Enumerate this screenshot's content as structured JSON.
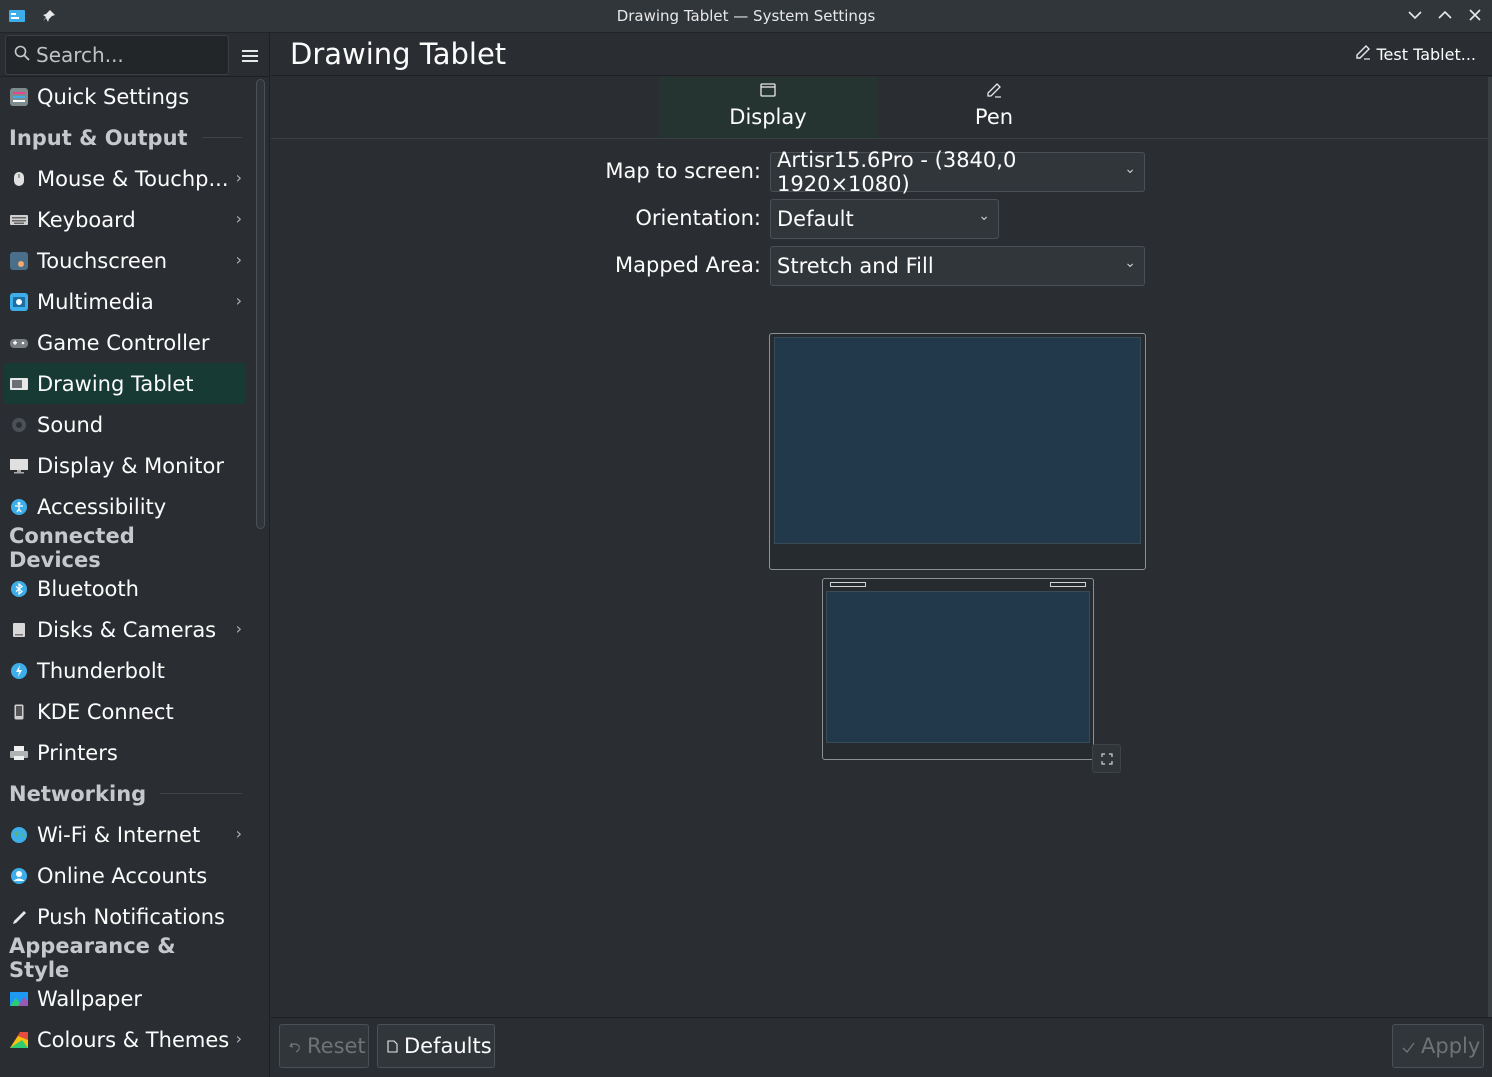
{
  "window": {
    "title": "Drawing Tablet — System Settings"
  },
  "search": {
    "placeholder": "Search..."
  },
  "sidebar": {
    "top_item": {
      "label": "Quick Settings",
      "icon": "quick-settings-icon"
    },
    "sections": [
      {
        "heading": "Input & Output",
        "items": [
          {
            "label": "Mouse & Touchp...",
            "icon": "mouse-icon",
            "chevron": true
          },
          {
            "label": "Keyboard",
            "icon": "keyboard-icon",
            "chevron": true
          },
          {
            "label": "Touchscreen",
            "icon": "touchscreen-icon",
            "chevron": true
          },
          {
            "label": "Multimedia",
            "icon": "multimedia-icon",
            "chevron": true
          },
          {
            "label": "Game Controller",
            "icon": "gamepad-icon",
            "chevron": false
          },
          {
            "label": "Drawing Tablet",
            "icon": "tablet-icon",
            "chevron": false,
            "active": true
          },
          {
            "label": "Sound",
            "icon": "speaker-icon",
            "chevron": false
          },
          {
            "label": "Display & Monitor",
            "icon": "monitor-icon",
            "chevron": false
          },
          {
            "label": "Accessibility",
            "icon": "accessibility-icon",
            "chevron": false
          }
        ]
      },
      {
        "heading": "Connected Devices",
        "items": [
          {
            "label": "Bluetooth",
            "icon": "bluetooth-icon",
            "chevron": false
          },
          {
            "label": "Disks & Cameras",
            "icon": "disk-icon",
            "chevron": true
          },
          {
            "label": "Thunderbolt",
            "icon": "thunderbolt-icon",
            "chevron": false
          },
          {
            "label": "KDE Connect",
            "icon": "phone-icon",
            "chevron": false
          },
          {
            "label": "Printers",
            "icon": "printer-icon",
            "chevron": false
          }
        ]
      },
      {
        "heading": "Networking",
        "items": [
          {
            "label": "Wi-Fi & Internet",
            "icon": "globe-icon",
            "chevron": true
          },
          {
            "label": "Online Accounts",
            "icon": "accounts-icon",
            "chevron": false
          },
          {
            "label": "Push Notifications",
            "icon": "push-icon",
            "chevron": false
          }
        ]
      },
      {
        "heading": "Appearance & Style",
        "items": [
          {
            "label": "Wallpaper",
            "icon": "wallpaper-icon",
            "chevron": false
          },
          {
            "label": "Colours & Themes",
            "icon": "palette-icon",
            "chevron": true
          }
        ]
      }
    ]
  },
  "page": {
    "title": "Drawing Tablet",
    "test_button": "Test Tablet..."
  },
  "tabs": [
    {
      "label": "Display",
      "active": true
    },
    {
      "label": "Pen",
      "active": false
    }
  ],
  "form": {
    "map_to_screen": {
      "label": "Map to screen:",
      "value": "Artisr15.6Pro - (3840,0 1920×1080)"
    },
    "orientation": {
      "label": "Orientation:",
      "value": "Default"
    },
    "mapped_area": {
      "label": "Mapped Area:",
      "value": "Stretch and Fill"
    }
  },
  "footer": {
    "reset": "Reset",
    "defaults": "Defaults",
    "apply": "Apply"
  },
  "colors": {
    "background": "#2a2e32",
    "active_item": "#183a35",
    "screen_fill": "#21394a"
  }
}
